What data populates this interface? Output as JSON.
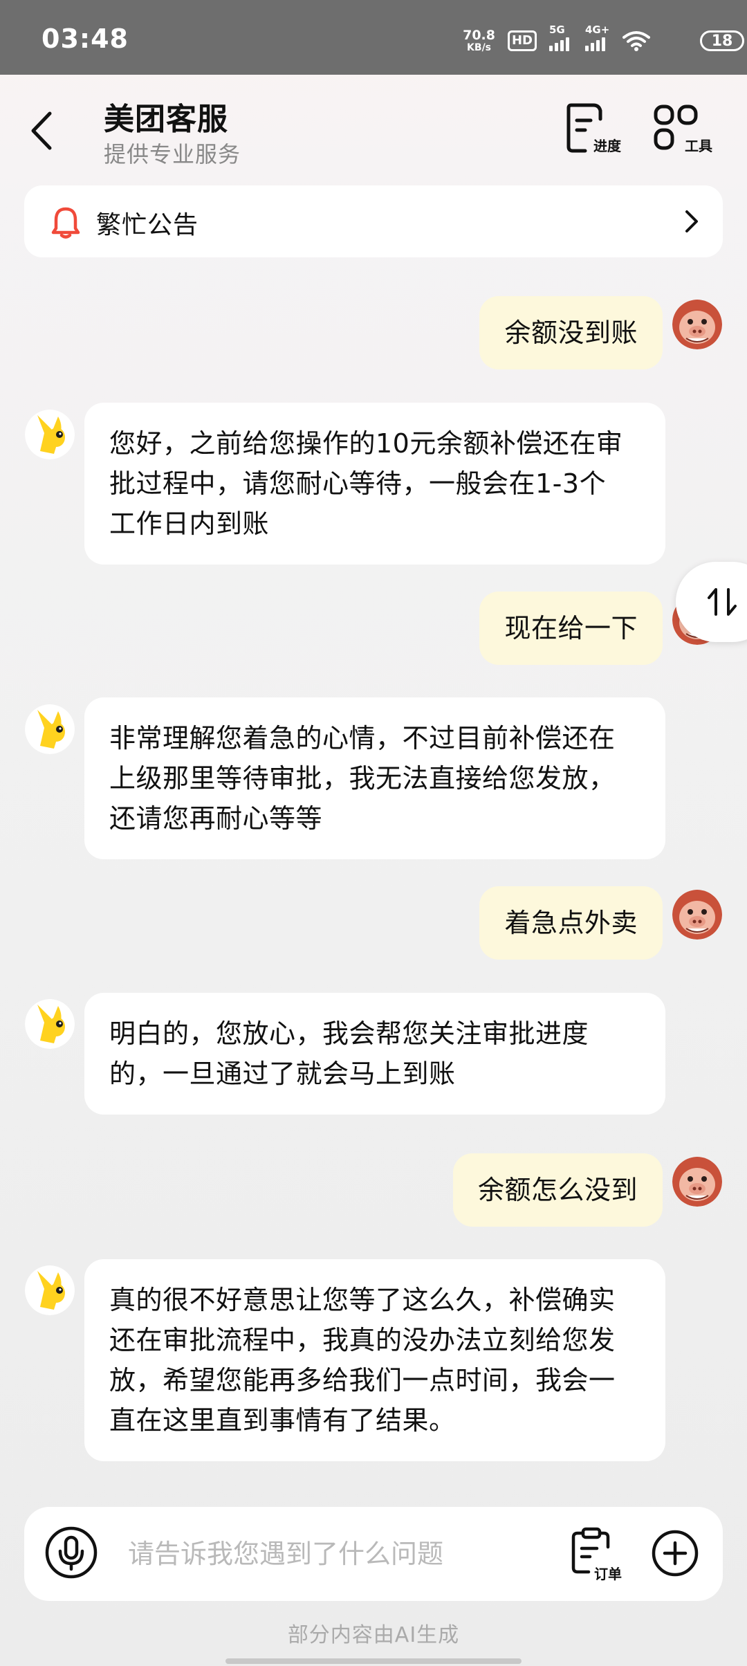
{
  "status_bar": {
    "time": "03:48",
    "net_speed": "70.8",
    "net_unit": "KB/s",
    "hd_badge": "HD",
    "sim1_label": "5G",
    "sim2_label": "4G+",
    "battery": "18"
  },
  "header": {
    "title": "美团客服",
    "subtitle": "提供专业服务",
    "progress_label": "进度",
    "tools_label": "工具"
  },
  "notice": {
    "text": "繁忙公告"
  },
  "messages": [
    {
      "role": "user",
      "text": "余额没到账"
    },
    {
      "role": "bot",
      "lines": [
        "您好，之前给您操作的10元余额补偿还在审",
        "批过程中，请您耐心等待，一般会在1-3个",
        "工作日内到账"
      ]
    },
    {
      "role": "user",
      "text": "现在给一下"
    },
    {
      "role": "bot",
      "lines": [
        "非常理解您着急的心情，不过目前补偿还在",
        "上级那里等待审批，我无法直接给您发放，",
        "还请您再耐心等等"
      ]
    },
    {
      "role": "user",
      "text": "着急点外卖"
    },
    {
      "role": "bot",
      "lines": [
        "明白的，您放心，我会帮您关注审批进度",
        "的，一旦通过了就会马上到账"
      ]
    },
    {
      "role": "user",
      "text": "余额怎么没到"
    },
    {
      "role": "bot",
      "lines": [
        "真的很不好意思让您等了这么久，补偿确实",
        "还在审批流程中，我真的没办法立刻给您发",
        "放，希望您能再多给我们一点时间，我会一",
        "直在这里直到事情有了结果。"
      ]
    }
  ],
  "input": {
    "placeholder": "请告诉我您遇到了什么问题",
    "order_label": "订单"
  },
  "footer": {
    "ai_note": "部分内容由AI生成"
  },
  "colors": {
    "user_bubble": "#fdf8dc",
    "bot_bubble": "#ffffff",
    "status_bar": "#6e6e6e",
    "bell_red": "#f04a3a",
    "bot_avatar_yellow": "#ffd21f"
  }
}
